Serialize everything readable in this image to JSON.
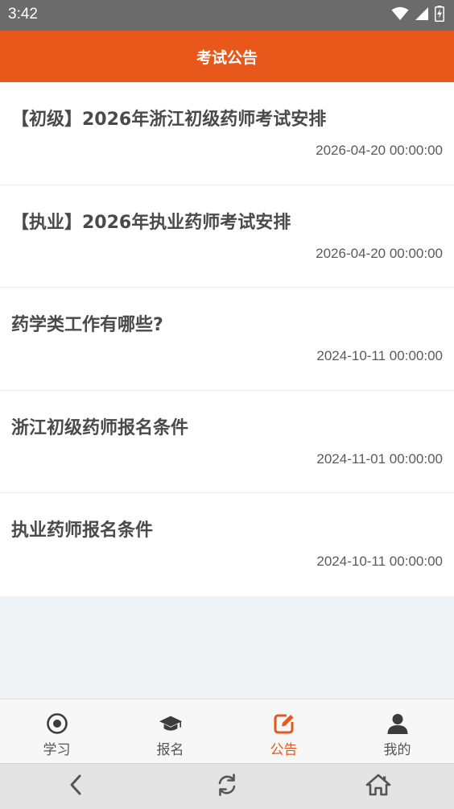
{
  "status_bar": {
    "time": "3:42",
    "icons": [
      "wifi-icon",
      "signal-icon",
      "battery-icon"
    ]
  },
  "header": {
    "title": "考试公告"
  },
  "notices": [
    {
      "title": "【初级】2026年浙江初级药师考试安排",
      "date": "2026-04-20 00:00:00"
    },
    {
      "title": "【执业】2026年执业药师考试安排",
      "date": "2026-04-20 00:00:00"
    },
    {
      "title": "药学类工作有哪些?",
      "date": "2024-10-11 00:00:00"
    },
    {
      "title": "浙江初级药师报名条件",
      "date": "2024-11-01 00:00:00"
    },
    {
      "title": "执业药师报名条件",
      "date": "2024-10-11 00:00:00"
    }
  ],
  "tabs": [
    {
      "label": "学习",
      "icon": "target-icon",
      "active": false
    },
    {
      "label": "报名",
      "icon": "graduation-cap-icon",
      "active": false
    },
    {
      "label": "公告",
      "icon": "edit-icon",
      "active": true
    },
    {
      "label": "我的",
      "icon": "person-icon",
      "active": false
    }
  ],
  "colors": {
    "accent": "#e8581b",
    "status_bar": "#6b6b6b",
    "tab_inactive": "#555555"
  },
  "nav_bar": {
    "icons": [
      "back-icon",
      "refresh-icon",
      "home-icon"
    ]
  }
}
